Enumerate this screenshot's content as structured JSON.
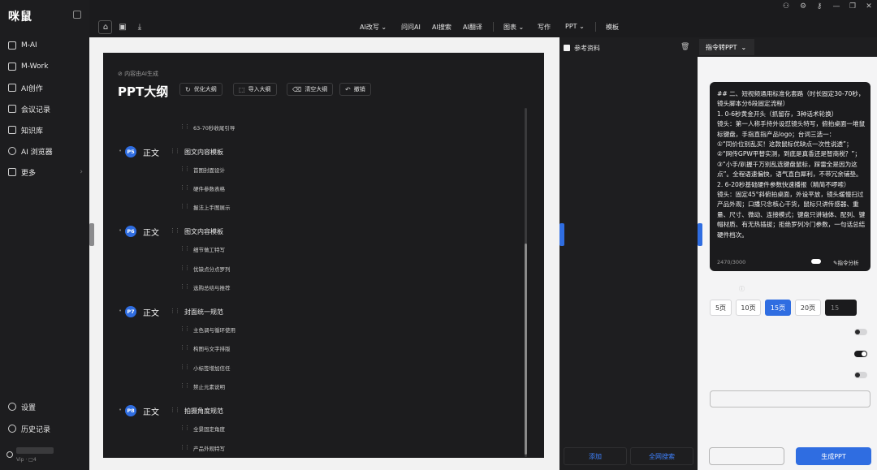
{
  "app": {
    "logo": "咪鼠"
  },
  "sidebar": {
    "items": [
      {
        "label": "M-AI",
        "icon": "chat-icon"
      },
      {
        "label": "M-Work",
        "icon": "hand-icon"
      },
      {
        "label": "AI创作",
        "icon": "image-icon"
      },
      {
        "label": "会议记录",
        "icon": "meeting-icon"
      },
      {
        "label": "知识库",
        "icon": "book-icon"
      },
      {
        "label": "AI 浏览器",
        "icon": "compass-icon"
      },
      {
        "label": "更多",
        "icon": "grid-icon"
      }
    ],
    "bottom": [
      {
        "label": "设置",
        "icon": "gear-icon"
      },
      {
        "label": "历史记录",
        "icon": "clock-icon"
      }
    ],
    "user": {
      "meta": "Vip · □4"
    }
  },
  "topbar": {
    "menu": [
      "AI改写",
      "问问AI",
      "AI搜索",
      "AI翻译",
      "图表",
      "写作",
      "PPT",
      "模板"
    ]
  },
  "doc": {
    "badge": "内容由AI生成",
    "title": "PPT大纲",
    "buttons": [
      "优化大纲",
      "导入大纲",
      "清空大纲",
      "撤销"
    ],
    "top_items": [
      "63-70秒收尾引导"
    ],
    "sections": [
      {
        "page": "P5",
        "type": "正文",
        "title": "图文内容模板",
        "items": [
          "首图封面设计",
          "硬件参数表格",
          "握法上手图展示"
        ]
      },
      {
        "page": "P6",
        "type": "正文",
        "title": "图文内容模板",
        "items": [
          "细节做工特写",
          "优缺点分点罗列",
          "选购总结与推荐"
        ]
      },
      {
        "page": "P7",
        "type": "正文",
        "title": "封面统一规范",
        "items": [
          "主色调与循环使用",
          "构图与文字排版",
          "小标签增加信任",
          "禁止元素说明"
        ]
      },
      {
        "page": "P8",
        "type": "正文",
        "title": "拍摄角度规范",
        "items": [
          "全景固定角度",
          "产品外观特写"
        ]
      }
    ]
  },
  "ref": {
    "title": "参考资料",
    "add_label": "添加",
    "search_label": "全网搜索"
  },
  "right": {
    "tab": "指令转PPT",
    "prompt_lines": [
      "## 二、短视频通用标准化套路（时长固定30-70秒，镜头脚本分6段固定流程）",
      "1. 0-6秒黄金开头（抓留存，3种话术轮换）",
      "镜头：第一人称手持外设怼镜头特写，俯拍桌面一堆鼠标键盘，手指直指产品logo；台词三选一：",
      "①“同价位别乱买！这款鼠标优缺点一次性说透”；②“网传GPW平替实测，到底是真香还是智商税？”；③“小手/趴握千万别乱选键盘鼠标，踩雷全是因为这点”。全程语速偏快，语气直白犀利，不带冗余铺垫。",
      "2. 6-20秒基础硬件参数快速播报（精简不啰嗦）",
      "镜头：固定45°斜俯拍桌面，外设平放，镜头缓慢扫过产品外观；口播只念核心干货，鼠标只讲传感器、重量、尺寸、微动、连接模式；键盘只讲轴体、配列、键帽材质、有无热插拔；拒绝罗列冷门参数，一句话总结硬件档次。"
    ],
    "count": "2470/3000",
    "analyze_label": "指令分析",
    "page_options": [
      "5页",
      "10页",
      "15页",
      "20页"
    ],
    "page_selected": "15页",
    "page_custom_value": "15",
    "toggles": [
      false,
      true,
      false
    ],
    "generate_label": "生成PPT",
    "colors": {
      "accent": "#2f6de1"
    }
  }
}
